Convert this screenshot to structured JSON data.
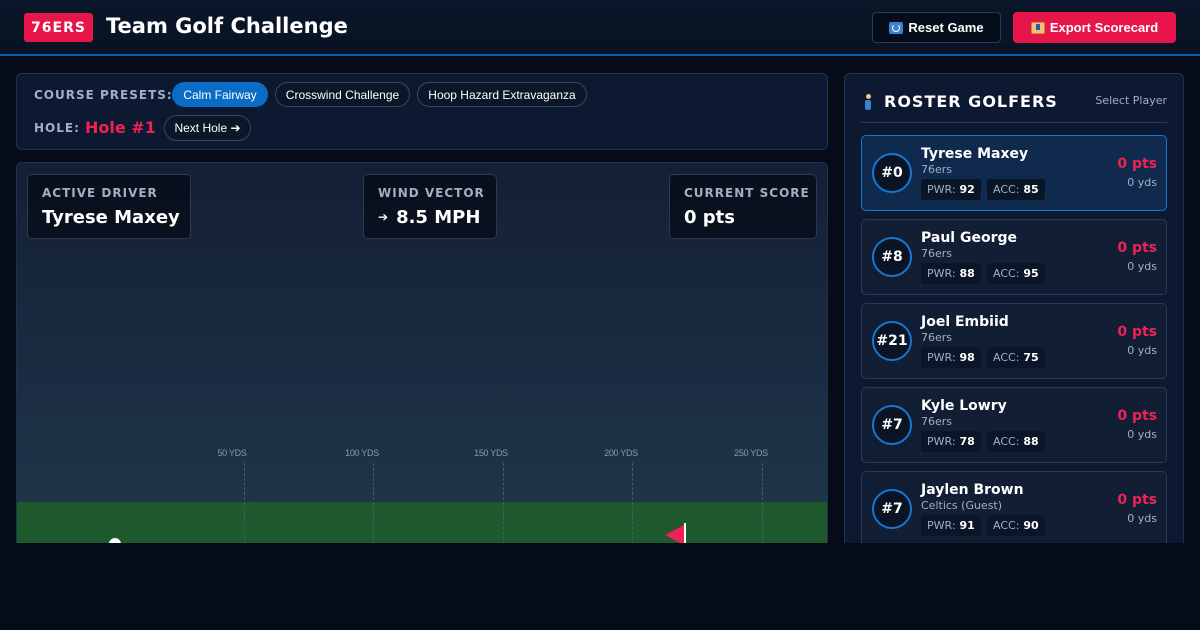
{
  "header": {
    "logo": "76ERS",
    "title": "Team Golf Challenge",
    "reset_label": "Reset Game",
    "export_label": "Export Scorecard"
  },
  "presets": {
    "label": "COURSE PRESETS:",
    "items": [
      "Calm Fairway",
      "Crosswind Challenge",
      "Hoop Hazard Extravaganza"
    ],
    "active_index": 0,
    "hole_label": "HOLE:",
    "hole_value": "Hole #1",
    "next_hole_label": "Next Hole ➔"
  },
  "hud": {
    "driver_label": "ACTIVE DRIVER",
    "driver_value": "Tyrese Maxey",
    "wind_label": "WIND VECTOR",
    "wind_arrow": "➔",
    "wind_value": "8.5 MPH",
    "score_label": "CURRENT SCORE",
    "score_value": "0 pts"
  },
  "course": {
    "yard_markers": [
      "50 YDS",
      "100 YDS",
      "150 YDS",
      "200 YDS",
      "250 YDS"
    ]
  },
  "roster": {
    "title": "ROSTER GOLFERS",
    "subtitle": "Select Player",
    "players": [
      {
        "number": "#0",
        "name": "Tyrese Maxey",
        "team": "76ers",
        "pwr_label": "PWR:",
        "pwr": "92",
        "acc_label": "ACC:",
        "acc": "85",
        "pts": "0 pts",
        "yds": "0 yds"
      },
      {
        "number": "#8",
        "name": "Paul George",
        "team": "76ers",
        "pwr_label": "PWR:",
        "pwr": "88",
        "acc_label": "ACC:",
        "acc": "95",
        "pts": "0 pts",
        "yds": "0 yds"
      },
      {
        "number": "#21",
        "name": "Joel Embiid",
        "team": "76ers",
        "pwr_label": "PWR:",
        "pwr": "98",
        "acc_label": "ACC:",
        "acc": "75",
        "pts": "0 pts",
        "yds": "0 yds"
      },
      {
        "number": "#7",
        "name": "Kyle Lowry",
        "team": "76ers",
        "pwr_label": "PWR:",
        "pwr": "78",
        "acc_label": "ACC:",
        "acc": "88",
        "pts": "0 pts",
        "yds": "0 yds"
      },
      {
        "number": "#7",
        "name": "Jaylen Brown",
        "team": "Celtics (Guest)",
        "pwr_label": "PWR:",
        "pwr": "91",
        "acc_label": "ACC:",
        "acc": "90",
        "pts": "0 pts",
        "yds": "0 yds"
      }
    ]
  },
  "colors": {
    "accent": "#e8154a",
    "primary": "#0a6cc5",
    "background": "#050b17",
    "grass": "#1e5a2d"
  }
}
